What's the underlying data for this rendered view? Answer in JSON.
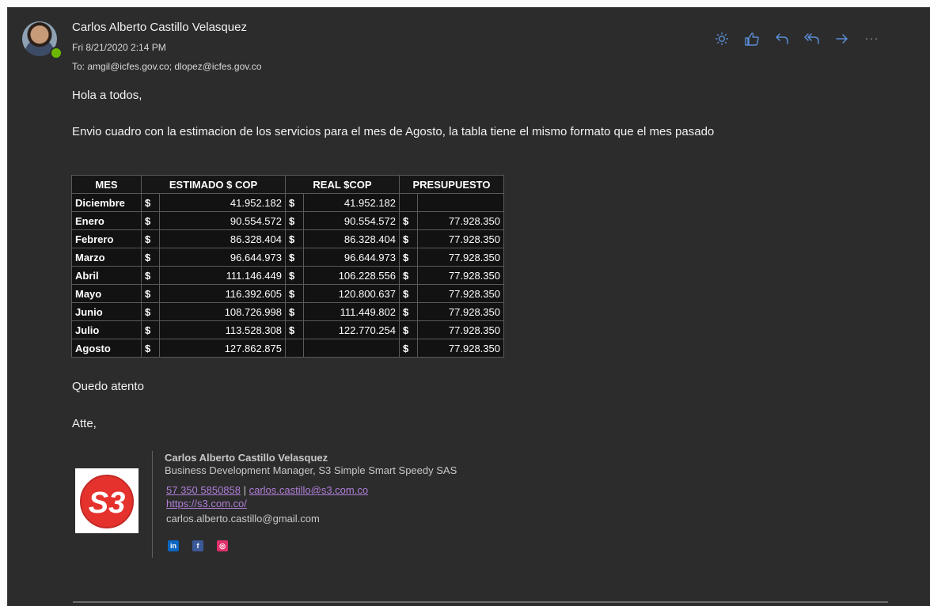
{
  "email": {
    "sender_name": "Carlos Alberto Castillo Velasquez",
    "date": "Fri 8/21/2020 2:14 PM",
    "to_label": "To:",
    "recipients": "amgil@icfes.gov.co; dlopez@icfes.gov.co"
  },
  "toolbar": {
    "icons": [
      "sun-icon",
      "like-icon",
      "reply-icon",
      "reply-all-icon",
      "forward-icon",
      "more-icon"
    ],
    "accent_color": "#5a8ed6"
  },
  "body": {
    "greeting": "Hola a todos,",
    "message": "Envio cuadro con la estimacion de los servicios para el mes de Agosto,  la tabla tiene el mismo formato que el mes pasado",
    "closing": "Quedo atento",
    "signoff": "Atte,"
  },
  "table": {
    "headers": [
      "MES",
      "ESTIMADO $ COP",
      "REAL  $COP",
      "PRESUPUESTO"
    ],
    "currency": "$",
    "rows": [
      {
        "mes": "Diciembre",
        "estimado": "41.952.182",
        "real": "41.952.182",
        "presupuesto": ""
      },
      {
        "mes": "Enero",
        "estimado": "90.554.572",
        "real": "90.554.572",
        "presupuesto": "77.928.350"
      },
      {
        "mes": "Febrero",
        "estimado": "86.328.404",
        "real": "86.328.404",
        "presupuesto": "77.928.350"
      },
      {
        "mes": "Marzo",
        "estimado": "96.644.973",
        "real": "96.644.973",
        "presupuesto": "77.928.350"
      },
      {
        "mes": "Abril",
        "estimado": "111.146.449",
        "real": "106.228.556",
        "presupuesto": "77.928.350"
      },
      {
        "mes": "Mayo",
        "estimado": "116.392.605",
        "real": "120.800.637",
        "presupuesto": "77.928.350"
      },
      {
        "mes": "Junio",
        "estimado": "108.726.998",
        "real": "111.449.802",
        "presupuesto": "77.928.350"
      },
      {
        "mes": "Julio",
        "estimado": "113.528.308",
        "real": "122.770.254",
        "presupuesto": "77.928.350"
      },
      {
        "mes": "Agosto",
        "estimado": "127.862.875",
        "real": "",
        "presupuesto": "77.928.350"
      }
    ]
  },
  "signature": {
    "name": "Carlos Alberto Castillo Velasquez",
    "role": "Business Development Manager, S3 Simple Smart Speedy SAS",
    "phone": "57 350 5850858",
    "separator": " | ",
    "email": "carlos.castillo@s3.com.co",
    "website": "https://s3.com.co/",
    "personal_email": "carlos.alberto.castillo@gmail.com",
    "logo_text": "S3",
    "social": [
      {
        "icon": "linkedin-icon",
        "glyph": "in",
        "color": "#0a66c2"
      },
      {
        "icon": "facebook-icon",
        "glyph": "f",
        "color": "#3b5998"
      },
      {
        "icon": "instagram-icon",
        "glyph": "◎",
        "color": "#e1306c"
      }
    ]
  }
}
